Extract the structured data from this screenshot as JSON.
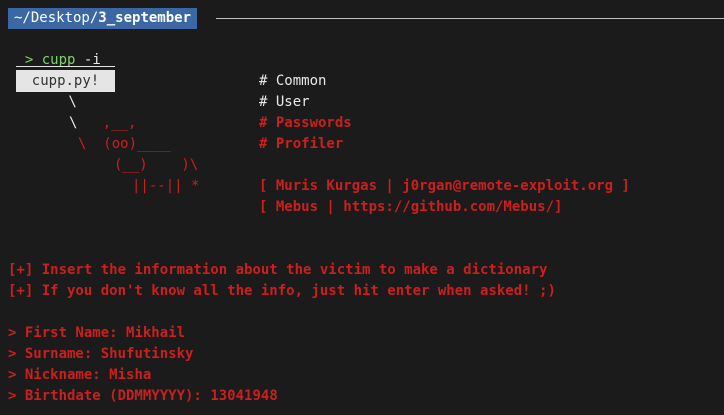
{
  "prompt": {
    "home": "~/Desktop/",
    "dir": "3_september",
    "symbol": ">",
    "command": "cupp",
    "flag": "-i"
  },
  "banner": {
    "bubble": "cupp.py!",
    "art": [
      " \\",
      "  \\   ,__,",
      "   \\  (oo)____",
      "      (__)    )\\",
      "         ||--|| *"
    ],
    "menu": [
      "# Common",
      "# User",
      "# Passwords",
      "# Profiler"
    ],
    "credits": [
      "[ Muris Kurgas | j0rgan@remote-exploit.org ]",
      "[ Mebus | https://github.com/Mebus/]"
    ]
  },
  "messages": [
    "[+] Insert the information about the victim to make a dictionary",
    "[+] If you don't know all the info, just hit enter when asked! ;)"
  ],
  "fields": [
    {
      "label": "> First Name:",
      "value": "Mikhail"
    },
    {
      "label": "> Surname:",
      "value": "Shufutinsky"
    },
    {
      "label": "> Nickname:",
      "value": "Misha"
    },
    {
      "label": "> Birthdate (DDMMYYYY):",
      "value": "13041948"
    }
  ],
  "colors": {
    "accent": "#3b67a4",
    "prompt": "#7fd36b",
    "cupp": "#cc1f1f"
  }
}
